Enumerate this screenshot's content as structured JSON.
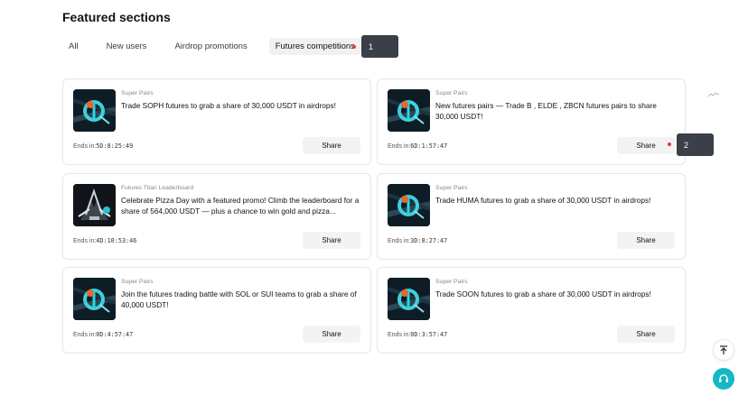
{
  "page": {
    "title": "Featured sections"
  },
  "tabs": [
    {
      "label": "All",
      "active": false
    },
    {
      "label": "New users",
      "active": false
    },
    {
      "label": "Airdrop promotions",
      "active": false
    },
    {
      "label": "Futures competitions",
      "active": true
    }
  ],
  "cards": [
    {
      "category": "Super Pairs",
      "title": "Trade SOPH futures to grab a share of 30,000 USDT in airdrops!",
      "ends_label": "Ends in:",
      "timer": "5D:8:25:49",
      "share_label": "Share",
      "thumb": "super-pairs-icon"
    },
    {
      "category": "Super Pairs",
      "title": "New futures pairs — Trade B , ELDE , ZBCN futures pairs to share 30,000 USDT!",
      "ends_label": "Ends in:",
      "timer": "6D:1:57:47",
      "share_label": "Share",
      "thumb": "super-pairs-icon"
    },
    {
      "category": "Futures Titan Leaderboard",
      "title": "Celebrate Pizza Day with a featured promo! Climb the leaderboard for a share of 564,000 USDT — plus a chance to win gold and pizza...",
      "ends_label": "Ends in:",
      "timer": "4D:10:53:46",
      "share_label": "Share",
      "thumb": "titan-leaderboard-icon"
    },
    {
      "category": "Super Pairs",
      "title": "Trade HUMA futures to grab a share of 30,000 USDT in airdrops!",
      "ends_label": "Ends in:",
      "timer": "3D:8:27:47",
      "share_label": "Share",
      "thumb": "super-pairs-icon"
    },
    {
      "category": "Super Pairs",
      "title": "Join the futures trading battle with SOL or SUI teams to grab a share of 40,000 USDT!",
      "ends_label": "Ends in:",
      "timer": "0D:4:57:47",
      "share_label": "Share",
      "thumb": "super-pairs-icon"
    },
    {
      "category": "Super Pairs",
      "title": "Trade SOON futures to grab a share of 30,000 USDT in airdrops!",
      "ends_label": "Ends in:",
      "timer": "0D:3:57:47",
      "share_label": "Share",
      "thumb": "super-pairs-icon"
    }
  ],
  "markers": [
    {
      "label": "1"
    },
    {
      "label": "2"
    }
  ],
  "floating": {
    "top_icon": "arrow-up-to-top-icon",
    "support_icon": "headset-support-icon"
  },
  "colors": {
    "accent": "#14b8c4",
    "marker_bg": "#3b3f47",
    "marker_dot": "#e53935",
    "tab_active_bg": "#f1f1f1"
  }
}
